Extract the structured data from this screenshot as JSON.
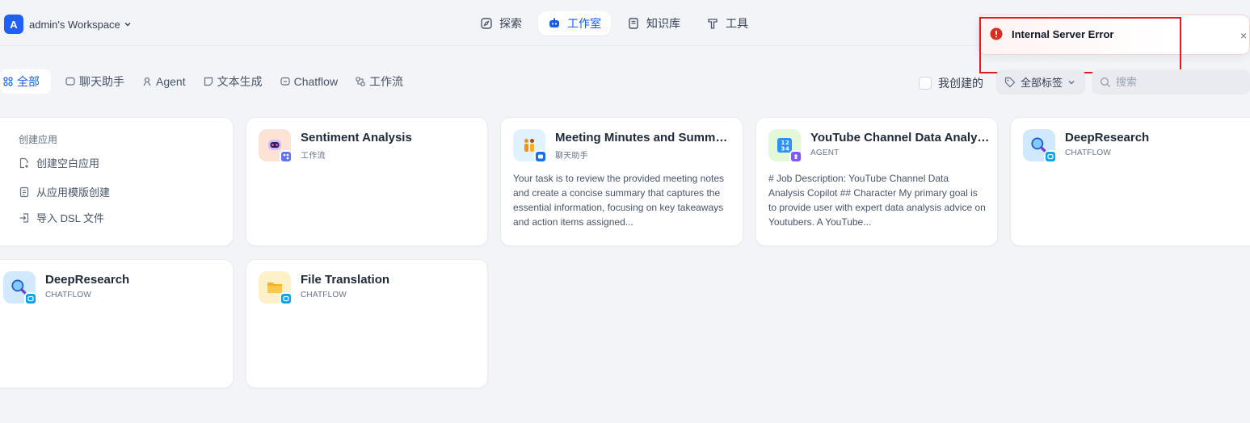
{
  "workspace": {
    "avatar_letter": "A",
    "name": "admin's Workspace"
  },
  "nav": {
    "items": [
      {
        "label": "探索",
        "icon": "compass-icon"
      },
      {
        "label": "工作室",
        "icon": "robot-icon",
        "active": true
      },
      {
        "label": "知识库",
        "icon": "book-icon"
      },
      {
        "label": "工具",
        "icon": "hammer-icon"
      }
    ]
  },
  "toast": {
    "message": "Internal Server Error",
    "close": "×"
  },
  "filters": {
    "tabs": [
      {
        "label": "全部",
        "icon": "grid-icon",
        "active": true
      },
      {
        "label": "聊天助手",
        "icon": "chat-icon"
      },
      {
        "label": "Agent",
        "icon": "agent-icon"
      },
      {
        "label": "文本生成",
        "icon": "text-icon"
      },
      {
        "label": "Chatflow",
        "icon": "chatflow-icon"
      },
      {
        "label": "工作流",
        "icon": "workflow-icon"
      }
    ],
    "mine_label": "我创建的",
    "tags_label": "全部标签",
    "search_placeholder": "搜索"
  },
  "create_card": {
    "title": "创建应用",
    "items": [
      "创建空白应用",
      "从应用模版创建",
      "导入 DSL 文件"
    ]
  },
  "apps": [
    {
      "name": "Sentiment Analysis",
      "type": "工作流",
      "desc": "",
      "icon": "robot-face-icon",
      "badge": "workflow-badge-icon",
      "icon_bg": "#fde2d6",
      "badge_color": "#6172f3"
    },
    {
      "name": "Meeting Minutes and Summary",
      "type": "聊天助手",
      "desc": "Your task is to review the provided meeting notes and create a concise summary that captures the essential information, focusing on key takeaways and action items assigned...",
      "icon": "people-icon",
      "badge": "chat-badge-icon",
      "icon_bg": "#e0f2fe",
      "badge_color": "#1570ef"
    },
    {
      "name": "YouTube Channel Data Analysis",
      "type": "AGENT",
      "desc": "# Job Description: YouTube Channel Data Analysis Copilot ## Character My primary goal is to provide user with expert data analysis advice on Youtubers. A YouTube...",
      "icon": "numbers-icon",
      "badge": "agent-badge-icon",
      "icon_bg": "#e3f7d9",
      "badge_color": "#7a5af8"
    },
    {
      "name": "DeepResearch",
      "type": "CHATFLOW",
      "desc": "",
      "icon": "magnifier-icon",
      "badge": "chatflow-badge-icon",
      "icon_bg": "#d1e9ff",
      "badge_color": "#0ba5ec"
    },
    {
      "name": "DeepResearch",
      "type": "CHATFLOW",
      "desc": "",
      "icon": "magnifier-icon",
      "badge": "chatflow-badge-icon",
      "icon_bg": "#d1e9ff",
      "badge_color": "#0ba5ec"
    },
    {
      "name": "File Translation",
      "type": "CHATFLOW",
      "desc": "",
      "icon": "folder-icon",
      "badge": "chatflow-badge-icon",
      "icon_bg": "#fef0c7",
      "badge_color": "#0ba5ec"
    }
  ]
}
